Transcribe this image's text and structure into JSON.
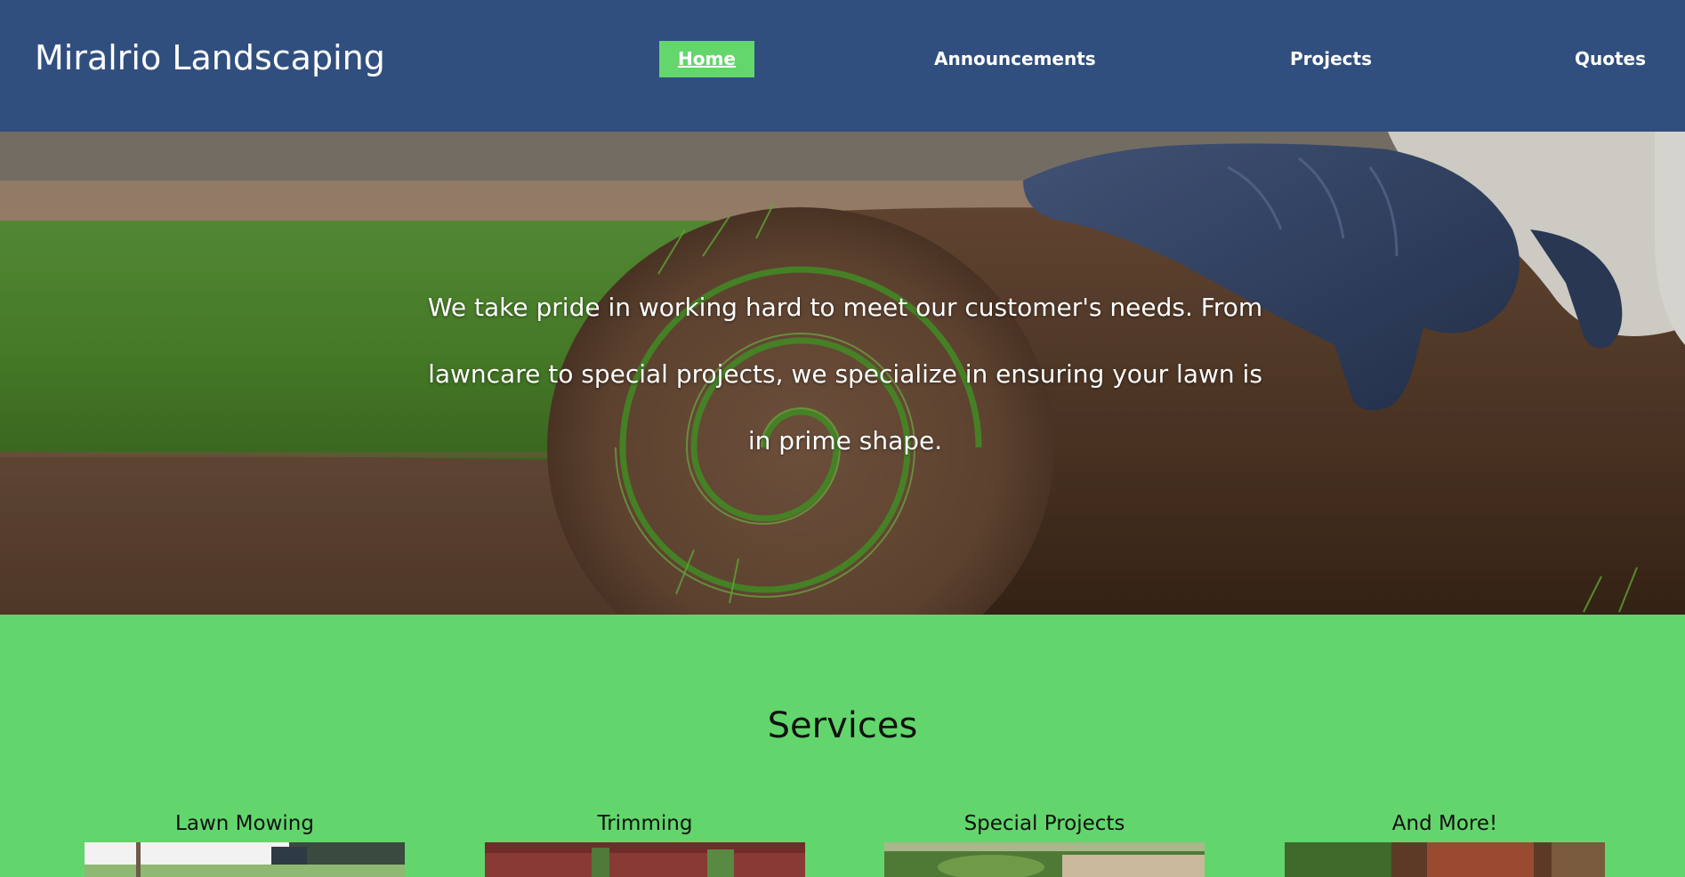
{
  "header": {
    "brand": "Miralrio Landscaping",
    "nav": {
      "home": "Home",
      "announcements": "Announcements",
      "projects": "Projects",
      "quotes": "Quotes"
    },
    "active_item": "Home",
    "background_color": "#314f7e",
    "active_color": "#63d66c"
  },
  "hero": {
    "tagline": "We take pride in working hard to meet our customer's needs. From lawncare to special projects, we specialize in ensuring your lawn is in prime shape."
  },
  "services": {
    "title": "Services",
    "background_color": "#62d66c",
    "items": [
      {
        "label": "Lawn Mowing"
      },
      {
        "label": "Trimming"
      },
      {
        "label": "Special Projects"
      },
      {
        "label": "And More!"
      }
    ]
  }
}
